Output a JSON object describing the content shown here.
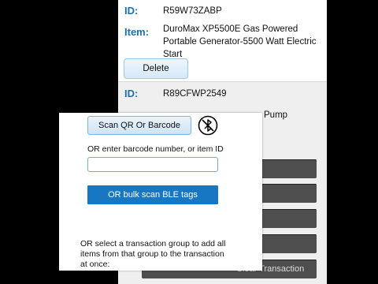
{
  "item1": {
    "id_label": "ID:",
    "id_value": "R59W73ZABP",
    "item_label": "Item:",
    "item_value_lines": [
      "DuroMax XP5500E Gas Powered",
      "Portable Generator-5500 Watt Electric",
      "Start"
    ],
    "delete_label": "Delete"
  },
  "item2": {
    "id_label": "ID:",
    "id_value": "R89CFWP2549",
    "item_value_partial": "Pump"
  },
  "bottom_button": {
    "label": "Clear Transaction"
  },
  "modal": {
    "scan_button_label": "Scan QR Or Barcode",
    "ble_icon": "bluetooth-disabled-icon",
    "enter_barcode_text": "OR enter barcode number, or item ID",
    "barcode_input_value": "",
    "barcode_input_placeholder": "",
    "bulk_scan_label": "OR bulk scan BLE tags",
    "group_text_lines": [
      "OR select a transaction group to add all",
      "items from that group to the transaction",
      "at once:"
    ]
  }
}
